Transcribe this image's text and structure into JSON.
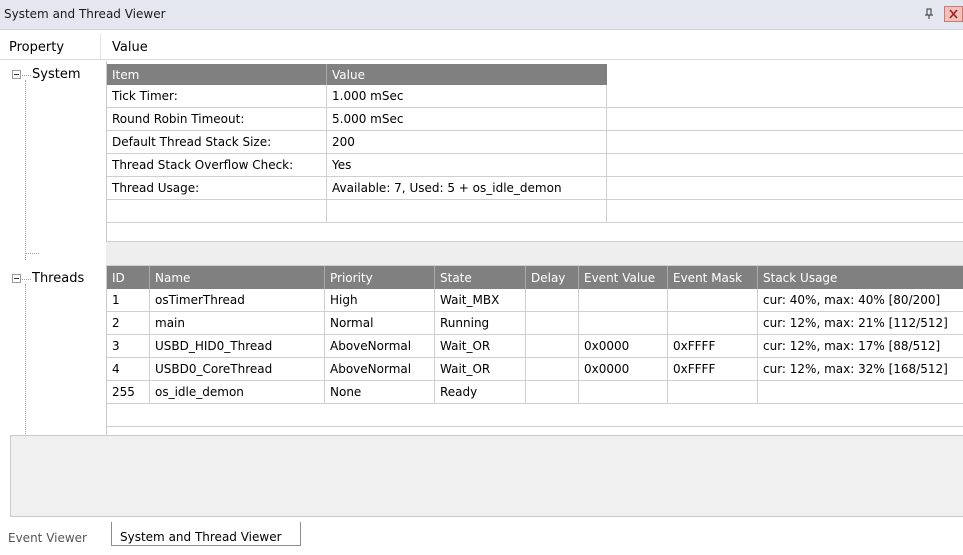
{
  "window": {
    "title": "System and Thread Viewer",
    "pin_icon": "pin-icon",
    "close_icon": "close-icon"
  },
  "columns": {
    "property": "Property",
    "value": "Value"
  },
  "tree": {
    "system_label": "System",
    "threads_label": "Threads"
  },
  "system_table": {
    "headers": [
      "Item",
      "Value"
    ],
    "rows": [
      [
        "Tick Timer:",
        "1.000 mSec"
      ],
      [
        "Round Robin Timeout:",
        "5.000 mSec"
      ],
      [
        "Default Thread Stack Size:",
        "200"
      ],
      [
        "Thread Stack Overflow Check:",
        "Yes"
      ],
      [
        "Thread Usage:",
        "Available: 7, Used: 5 + os_idle_demon"
      ]
    ]
  },
  "threads_table": {
    "headers": [
      "ID",
      "Name",
      "Priority",
      "State",
      "Delay",
      "Event Value",
      "Event Mask",
      "Stack Usage"
    ],
    "rows": [
      [
        "1",
        "osTimerThread",
        "High",
        "Wait_MBX",
        "",
        "",
        "",
        "cur: 40%, max: 40% [80/200]"
      ],
      [
        "2",
        "main",
        "Normal",
        "Running",
        "",
        "",
        "",
        "cur: 12%, max: 21% [112/512]"
      ],
      [
        "3",
        "USBD_HID0_Thread",
        "AboveNormal",
        "Wait_OR",
        "",
        "0x0000",
        "0xFFFF",
        "cur: 12%, max: 17% [88/512]"
      ],
      [
        "4",
        "USBD0_CoreThread",
        "AboveNormal",
        "Wait_OR",
        "",
        "0x0000",
        "0xFFFF",
        "cur: 12%, max: 32% [168/512]"
      ],
      [
        "255",
        "os_idle_demon",
        "None",
        "Ready",
        "",
        "",
        "",
        ""
      ]
    ]
  },
  "tabs": [
    {
      "label": "Event Viewer",
      "active": false
    },
    {
      "label": "System and Thread Viewer",
      "active": true
    }
  ]
}
